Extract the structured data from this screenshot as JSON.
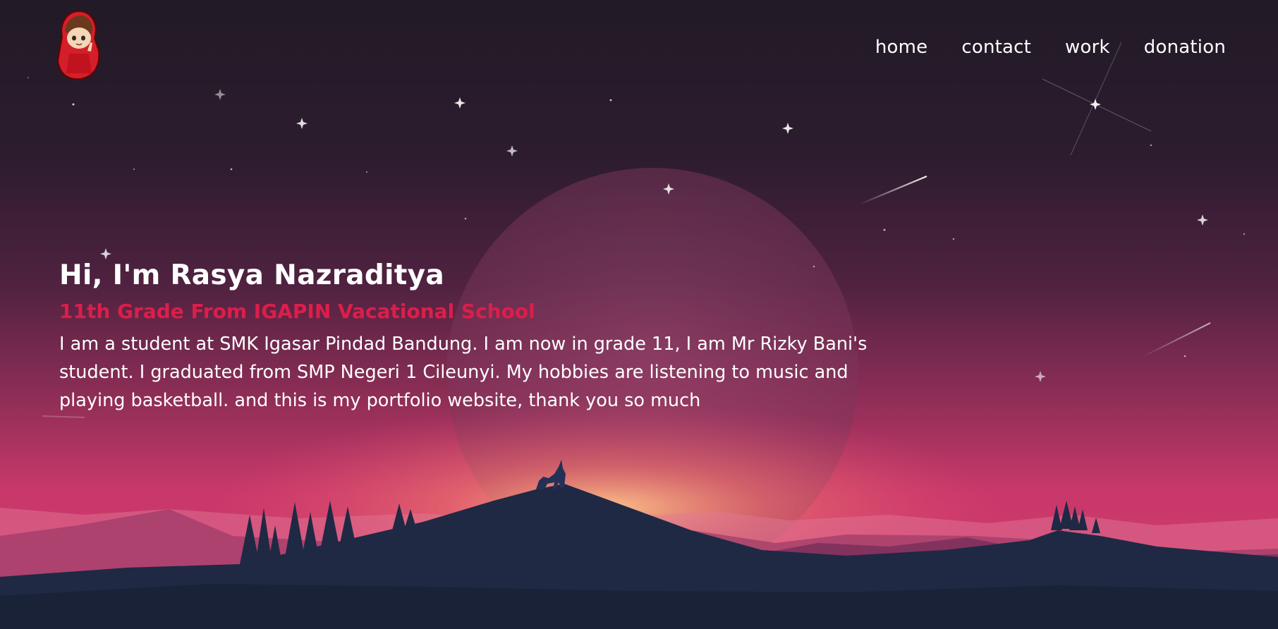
{
  "site": {
    "logo_icon": "chibi-avatar-icon"
  },
  "nav": {
    "items": [
      {
        "label": "home"
      },
      {
        "label": "contact"
      },
      {
        "label": "work"
      },
      {
        "label": "donation"
      }
    ]
  },
  "hero": {
    "title": "Hi, I'm Rasya Nazraditya",
    "subtitle": "11th Grade From IGAPIN Vacational School",
    "description": "I am a student at SMK Igasar Pindad Bandung. I am now in grade 11, I am Mr Rizky Bani's student. I graduated from SMP Negeri 1 Cileunyi. My hobbies are listening to music and playing basketball. and this is my portfolio website, thank you so much"
  },
  "colors": {
    "accent": "#dc1e4a",
    "text": "#ffffff",
    "sky_top": "#231a28",
    "sky_bottom": "#d43a6e"
  }
}
